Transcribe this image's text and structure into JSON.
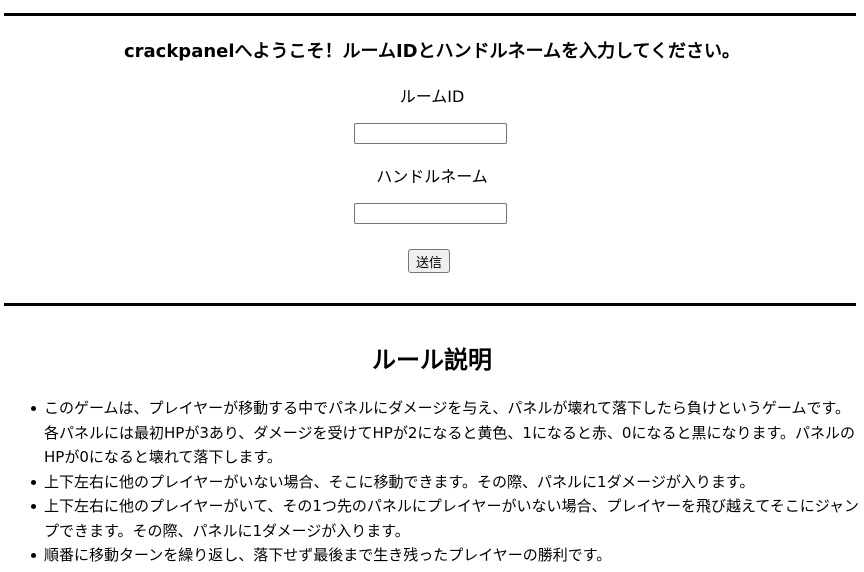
{
  "login": {
    "welcome": "crackpanelへようこそ！ルームIDとハンドルネームを入力してください。",
    "room_id_label": "ルームID",
    "room_id_value": "",
    "handle_label": "ハンドルネーム",
    "handle_value": "",
    "submit_label": "送信"
  },
  "rules": {
    "title": "ルール説明",
    "items": [
      "このゲームは、プレイヤーが移動する中でパネルにダメージを与え、パネルが壊れて落下したら負けというゲームです。各パネルには最初HPが3あり、ダメージを受けてHPが2になると黄色、1になると赤、0になると黒になります。パネルのHPが0になると壊れて落下します。",
      "上下左右に他のプレイヤーがいない場合、そこに移動できます。その際、パネルに1ダメージが入ります。",
      "上下左右に他のプレイヤーがいて、その1つ先のパネルにプレイヤーがいない場合、プレイヤーを飛び越えてそこにジャンプできます。その際、パネルに1ダメージが入ります。",
      "順番に移動ターンを繰り返し、落下せず最後まで生き残ったプレイヤーの勝利です。"
    ]
  }
}
